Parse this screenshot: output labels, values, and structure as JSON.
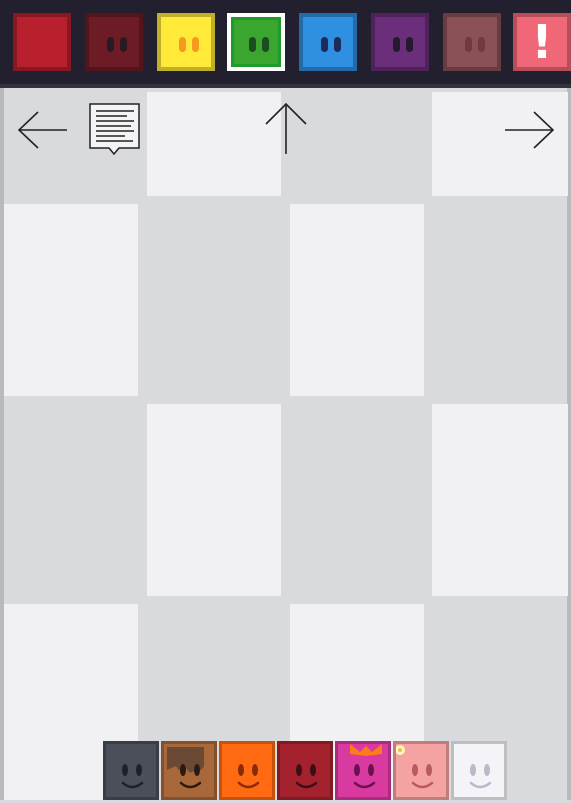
{
  "palette": [
    {
      "name": "red",
      "color": "#b8202e",
      "eyes": false
    },
    {
      "name": "dark-red",
      "color": "#6d1c25",
      "eyes": true,
      "eye_color": "#2a1a24"
    },
    {
      "name": "yellow",
      "color": "#ffea3a",
      "eyes": true,
      "eye_color": "#f59a1c"
    },
    {
      "name": "green",
      "color": "#3aa62f",
      "eyes": true,
      "eye_color": "#1c4d22",
      "selected": true
    },
    {
      "name": "blue",
      "color": "#2f8fe0",
      "eyes": true,
      "eye_color": "#1b2c5a"
    },
    {
      "name": "purple",
      "color": "#6a2e7a",
      "eyes": true,
      "eye_color": "#231a30"
    },
    {
      "name": "dusty-rose",
      "color": "#8a5156",
      "eyes": true,
      "eye_color": "#6f3a40"
    },
    {
      "name": "alert",
      "color": "#f06878",
      "eyes": false,
      "label": "!"
    }
  ],
  "controls": {
    "back": "arrow-left-icon",
    "notes": "notes-icon",
    "up": "arrow-up-icon",
    "forward": "arrow-right-icon"
  },
  "tray": [
    {
      "name": "slate",
      "color": "#4b4f5a",
      "face": "#1e2128"
    },
    {
      "name": "caramel",
      "color": "#a8683a",
      "face": "#2a1a14",
      "drip": "#6a4a34"
    },
    {
      "name": "orange",
      "color": "#ff6a12",
      "face": "#8a2a08"
    },
    {
      "name": "crimson",
      "color": "#a4222e",
      "face": "#3a1016"
    },
    {
      "name": "magenta",
      "color": "#d83aa0",
      "face": "#6a1050",
      "bow": "#ff7a1a"
    },
    {
      "name": "pink",
      "color": "#f4a2a2",
      "face": "#b85a60",
      "flower": "#fff6c0"
    },
    {
      "name": "white",
      "color": "#f4f4f8",
      "face": "#b8bac8"
    }
  ]
}
